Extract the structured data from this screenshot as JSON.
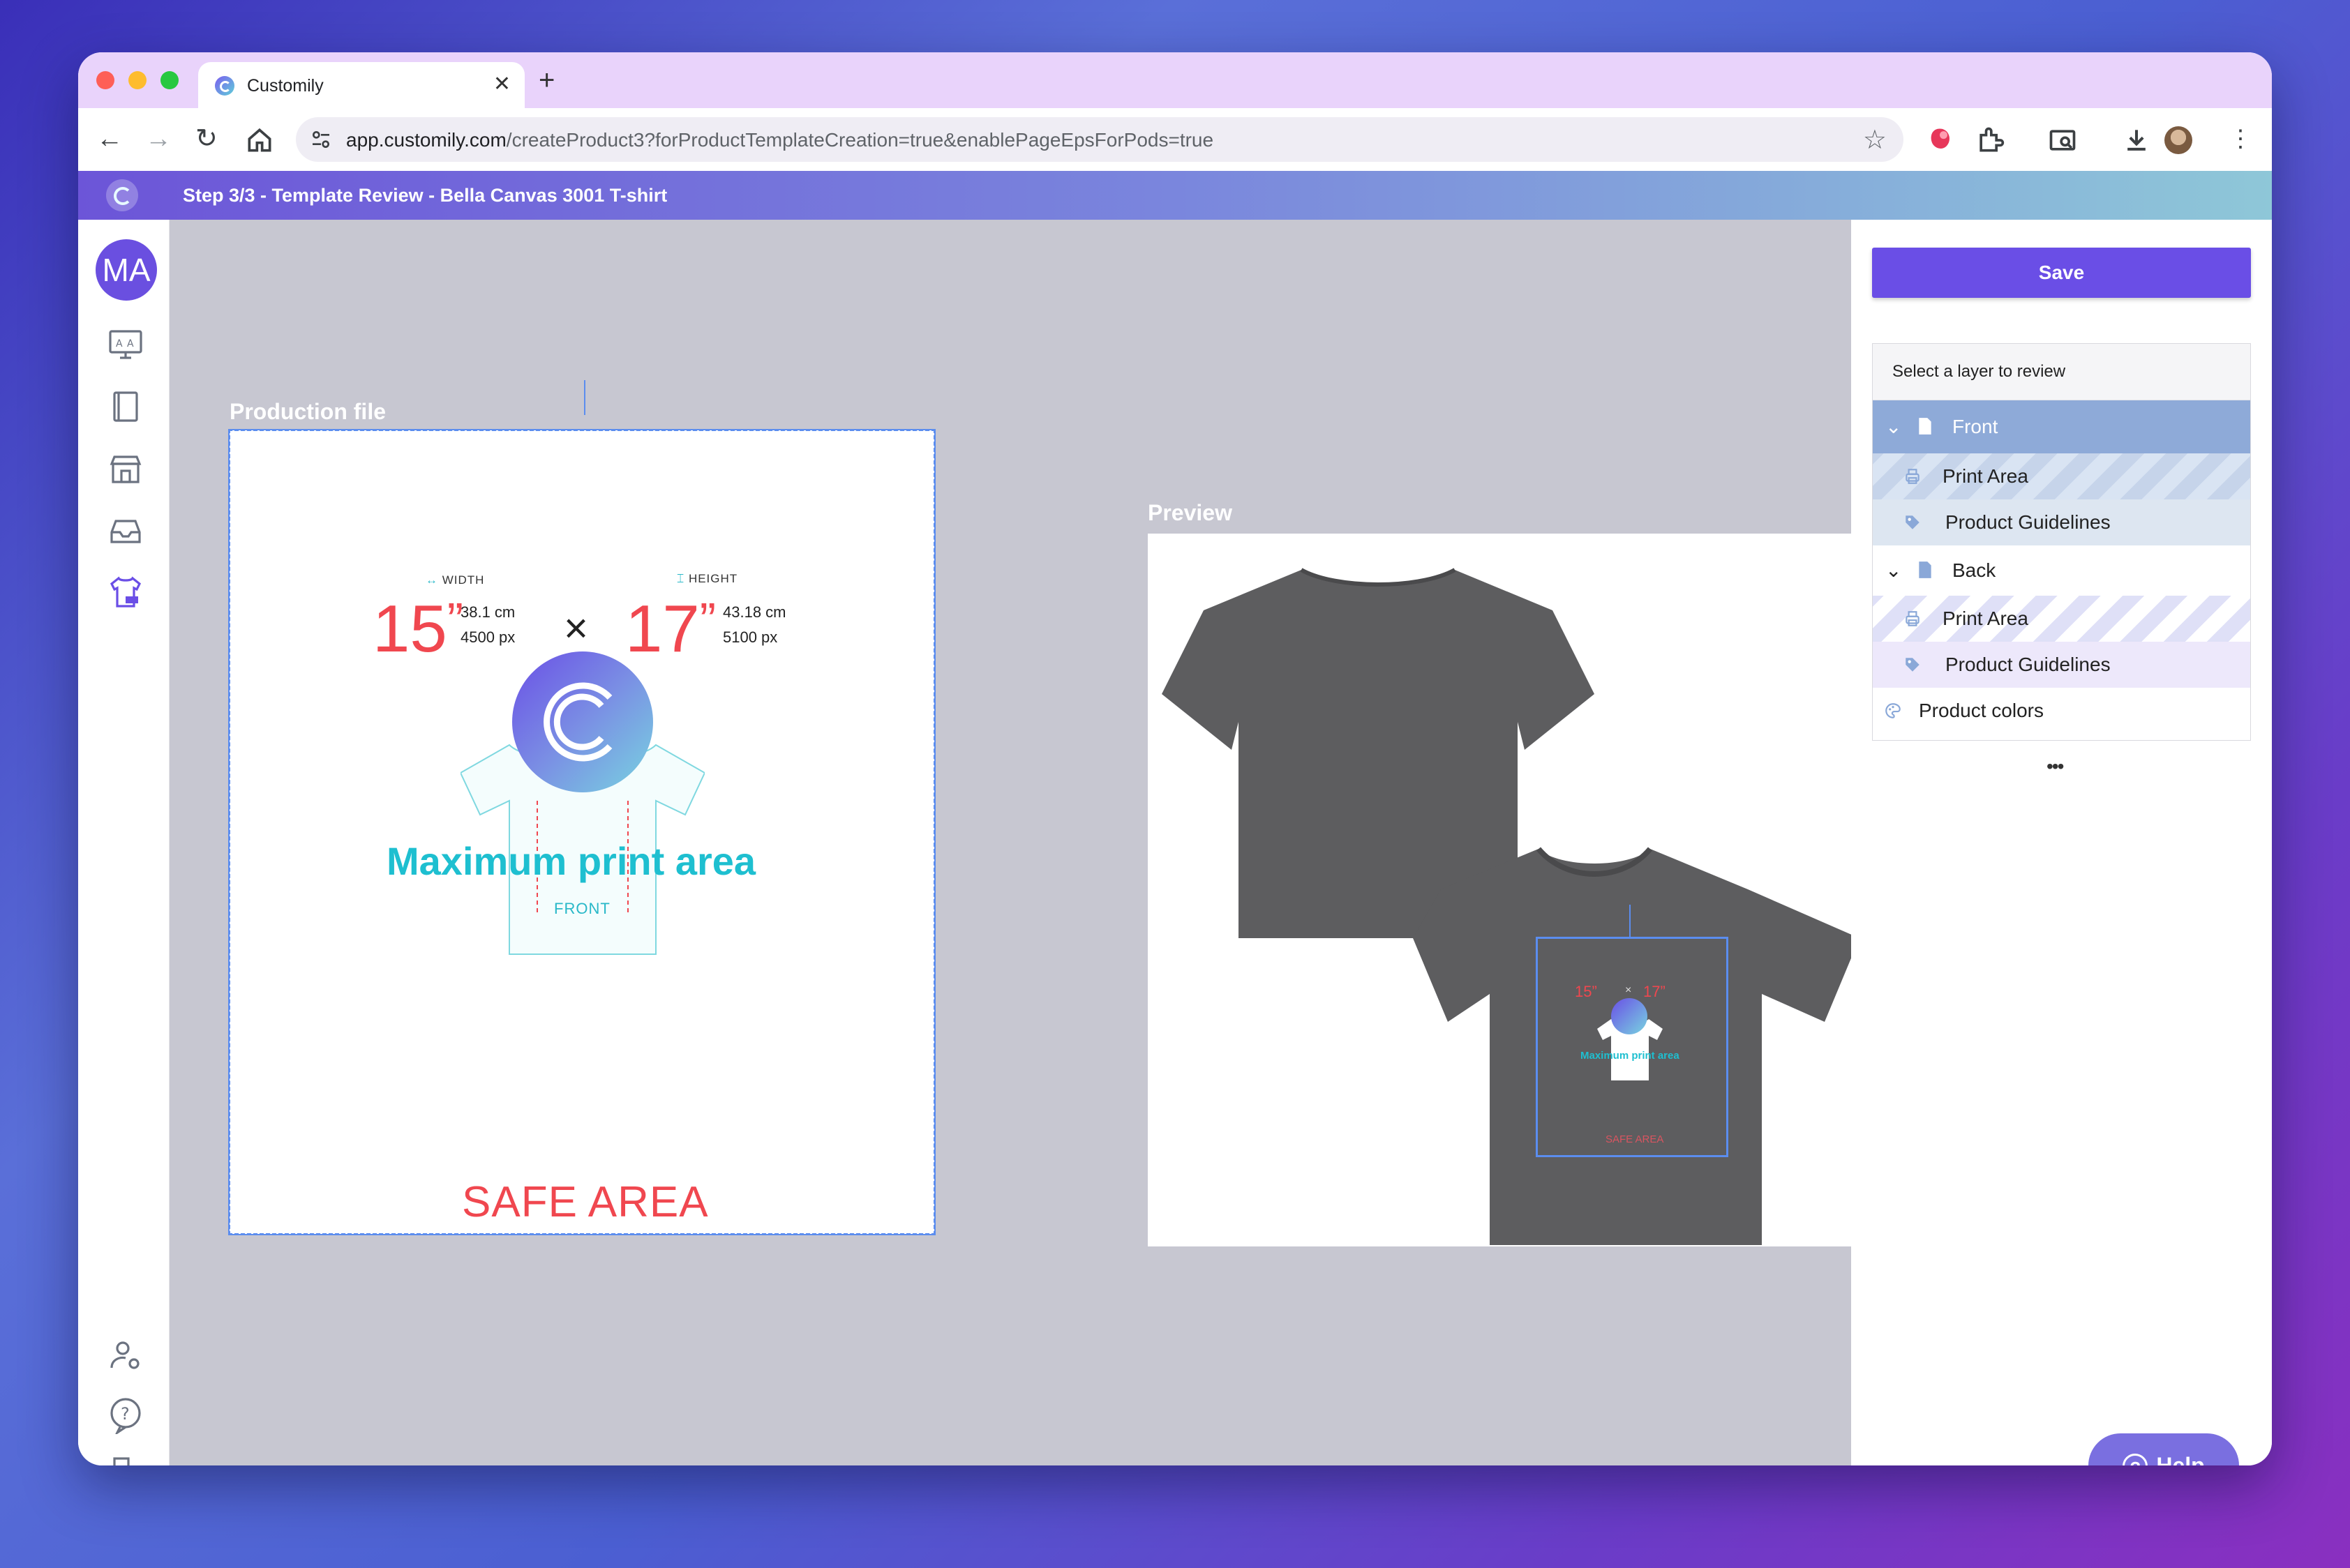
{
  "browser": {
    "tab_title": "Customily",
    "url_host": "app.customily.com",
    "url_path": "/createProduct3?forProductTemplateCreation=true&enablePageEpsForPods=true"
  },
  "app": {
    "step_title": "Step 3/3 - Template Review - Bella Canvas 3001 T-shirt",
    "user_initials": "MA"
  },
  "canvas": {
    "production_label": "Production file",
    "preview_label": "Preview",
    "width_label": "WIDTH",
    "height_label": "HEIGHT",
    "width_in": "15",
    "width_cm": "38.1 cm",
    "width_px": "4500 px",
    "height_in": "17",
    "height_cm": "43.18 cm",
    "height_px": "5100 px",
    "times": "×",
    "max_print": "Maximum print area",
    "front": "FRONT",
    "safe_area": "SAFE AREA",
    "mini_max_print": "Maximum print area",
    "mini_safe_area": "SAFE AREA"
  },
  "panel": {
    "save_label": "Save",
    "layers_header": "Select a layer to review",
    "front_label": "Front",
    "front_print_area": "Print Area",
    "front_guidelines": "Product Guidelines",
    "back_label": "Back",
    "back_print_area": "Print Area",
    "back_guidelines": "Product Guidelines",
    "product_colors": "Product colors",
    "drag_dots": "•••",
    "help_label": "Help"
  },
  "colors": {
    "accent": "#6a4ee6",
    "shirt": "#5d5d5f",
    "safe_red": "#f0474f",
    "print_teal": "#1ebfd0"
  }
}
